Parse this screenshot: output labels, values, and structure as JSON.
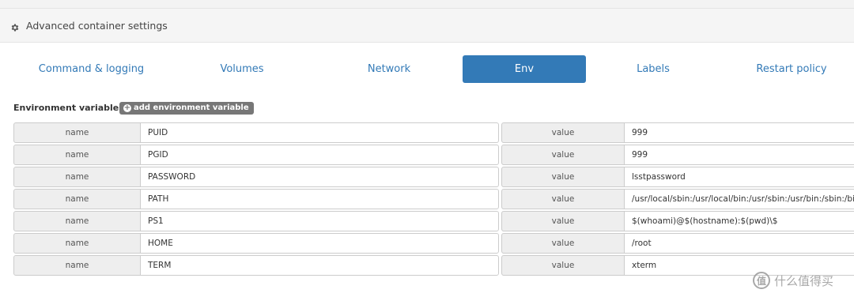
{
  "panel": {
    "title": "Advanced container settings",
    "icon": "gear-icon"
  },
  "tabs": [
    {
      "label": "Command & logging",
      "active": false
    },
    {
      "label": "Volumes",
      "active": false
    },
    {
      "label": "Network",
      "active": false
    },
    {
      "label": "Env",
      "active": true
    },
    {
      "label": "Labels",
      "active": false
    },
    {
      "label": "Restart policy",
      "active": false
    }
  ],
  "env": {
    "title": "Environment variables",
    "add_label": "add environment variable",
    "name_label": "name",
    "value_label": "value",
    "vars": [
      {
        "name": "PUID",
        "value": "999"
      },
      {
        "name": "PGID",
        "value": "999"
      },
      {
        "name": "PASSWORD",
        "value": "lsstpassword"
      },
      {
        "name": "PATH",
        "value": "/usr/local/sbin:/usr/local/bin:/usr/sbin:/usr/bin:/sbin:/bin"
      },
      {
        "name": "PS1",
        "value": "$(whoami)@$(hostname):$(pwd)\\$"
      },
      {
        "name": "HOME",
        "value": "/root"
      },
      {
        "name": "TERM",
        "value": "xterm"
      }
    ]
  },
  "watermark": {
    "text": "什么值得买",
    "logo": "值"
  },
  "colors": {
    "accent": "#337ab7",
    "button": "#777777"
  }
}
